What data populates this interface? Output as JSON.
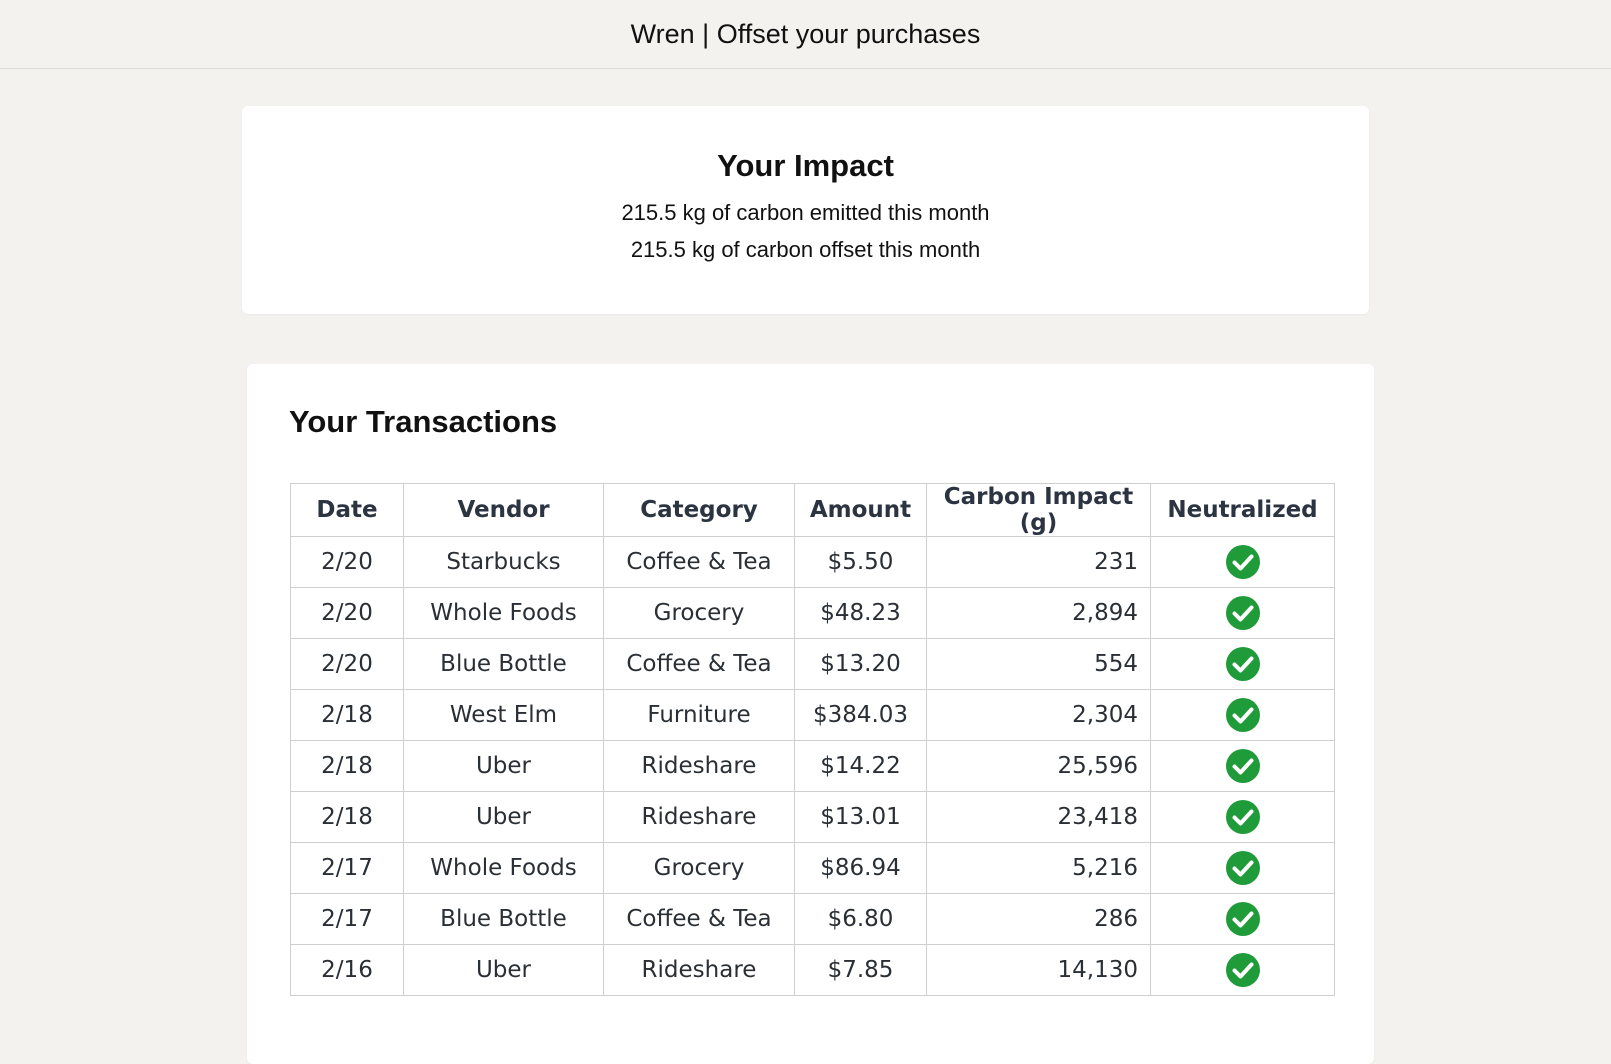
{
  "header": {
    "title": "Wren | Offset your purchases"
  },
  "impact": {
    "title": "Your Impact",
    "emitted_line": "215.5 kg of carbon emitted this month",
    "offset_line": "215.5 kg of carbon offset this month"
  },
  "transactions": {
    "title": "Your Transactions",
    "columns": [
      "Date",
      "Vendor",
      "Category",
      "Amount",
      "Carbon Impact (g)",
      "Neutralized"
    ],
    "rows": [
      {
        "date": "2/20",
        "vendor": "Starbucks",
        "category": "Coffee & Tea",
        "amount": "$5.50",
        "carbon": "231",
        "neutralized": true
      },
      {
        "date": "2/20",
        "vendor": "Whole Foods",
        "category": "Grocery",
        "amount": "$48.23",
        "carbon": "2,894",
        "neutralized": true
      },
      {
        "date": "2/20",
        "vendor": "Blue Bottle",
        "category": "Coffee & Tea",
        "amount": "$13.20",
        "carbon": "554",
        "neutralized": true
      },
      {
        "date": "2/18",
        "vendor": "West Elm",
        "category": "Furniture",
        "amount": "$384.03",
        "carbon": "2,304",
        "neutralized": true
      },
      {
        "date": "2/18",
        "vendor": "Uber",
        "category": "Rideshare",
        "amount": "$14.22",
        "carbon": "25,596",
        "neutralized": true
      },
      {
        "date": "2/18",
        "vendor": "Uber",
        "category": "Rideshare",
        "amount": "$13.01",
        "carbon": "23,418",
        "neutralized": true
      },
      {
        "date": "2/17",
        "vendor": "Whole Foods",
        "category": "Grocery",
        "amount": "$86.94",
        "carbon": "5,216",
        "neutralized": true
      },
      {
        "date": "2/17",
        "vendor": "Blue Bottle",
        "category": "Coffee & Tea",
        "amount": "$6.80",
        "carbon": "286",
        "neutralized": true
      },
      {
        "date": "2/16",
        "vendor": "Uber",
        "category": "Rideshare",
        "amount": "$7.85",
        "carbon": "14,130",
        "neutralized": true
      }
    ]
  },
  "icons": {
    "neutralized": "check-circle-icon"
  },
  "colors": {
    "page_background": "#f3f2ef",
    "card_background": "#ffffff",
    "check_green": "#1f9b3a"
  }
}
